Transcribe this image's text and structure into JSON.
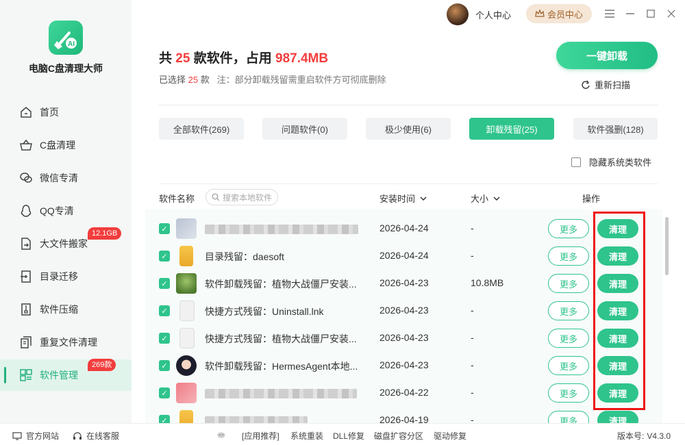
{
  "app": {
    "name": "电脑C盘清理大师",
    "version_label": "版本号:",
    "version": "V4.3.0"
  },
  "topbar": {
    "user_center": "个人中心",
    "vip_center": "会员中心"
  },
  "sidebar": {
    "items": [
      {
        "label": "首页",
        "icon": "home-icon"
      },
      {
        "label": "C盘清理",
        "icon": "basket-icon"
      },
      {
        "label": "微信专清",
        "icon": "wechat-icon"
      },
      {
        "label": "QQ专清",
        "icon": "qq-icon"
      },
      {
        "label": "大文件搬家",
        "icon": "move-file-icon",
        "badge": "12.1GB"
      },
      {
        "label": "目录迁移",
        "icon": "folder-migrate-icon"
      },
      {
        "label": "软件压缩",
        "icon": "compress-icon"
      },
      {
        "label": "重复文件清理",
        "icon": "duplicate-file-icon"
      },
      {
        "label": "软件管理",
        "icon": "software-manage-icon",
        "badge": "269款",
        "active": true
      }
    ]
  },
  "summary": {
    "prefix": "共",
    "count": "25",
    "mid": "款软件，占用",
    "size": "987.4MB",
    "selected_prefix": "已选择",
    "selected_count": "25",
    "selected_suffix": "款",
    "note": "注：部分卸载残留需重启软件方可彻底删除"
  },
  "actions": {
    "one_key_uninstall": "一键卸载",
    "rescan": "重新扫描"
  },
  "tabs": [
    {
      "label": "全部软件(269)"
    },
    {
      "label": "问题软件(0)"
    },
    {
      "label": "极少使用(6)"
    },
    {
      "label": "卸载残留(25)",
      "active": true
    },
    {
      "label": "软件强删(128)"
    }
  ],
  "hide_system": "隐藏系统类软件",
  "table": {
    "headers": {
      "name": "软件名称",
      "install_time": "安装时间",
      "size": "大小",
      "ops": "操作"
    },
    "search_placeholder": "搜索本地软件",
    "more_label": "更多",
    "clean_label": "清理",
    "rows": [
      {
        "name": "",
        "blurred": true,
        "date": "2026-04-24",
        "size": "-"
      },
      {
        "name": "目录残留：daesoft",
        "date": "2026-04-24",
        "size": "-"
      },
      {
        "name": "软件卸载残留：植物大战僵尸安装...",
        "date": "2026-04-23",
        "size": "10.8MB"
      },
      {
        "name": "快捷方式残留：Uninstall.lnk",
        "date": "2026-04-23",
        "size": "-"
      },
      {
        "name": "快捷方式残留：植物大战僵尸安装...",
        "date": "2026-04-23",
        "size": "-"
      },
      {
        "name": "软件卸载残留：HermesAgent本地...",
        "date": "2026-04-23",
        "size": "-"
      },
      {
        "name": "",
        "blurred": true,
        "date": "2026-04-22",
        "size": "-"
      },
      {
        "name": "",
        "blurred": true,
        "date": "2026-04-19",
        "size": "-"
      }
    ]
  },
  "footer": {
    "official_site": "官方网站",
    "online_service": "在线客服",
    "app_recommend": "[应用推荐]",
    "links": [
      "系统重装",
      "DLL修复",
      "磁盘扩容分区",
      "驱动修复"
    ]
  },
  "colors": {
    "accent": "#2fc48c",
    "red": "#f23d3d",
    "highlight_box": "#ee1111"
  }
}
